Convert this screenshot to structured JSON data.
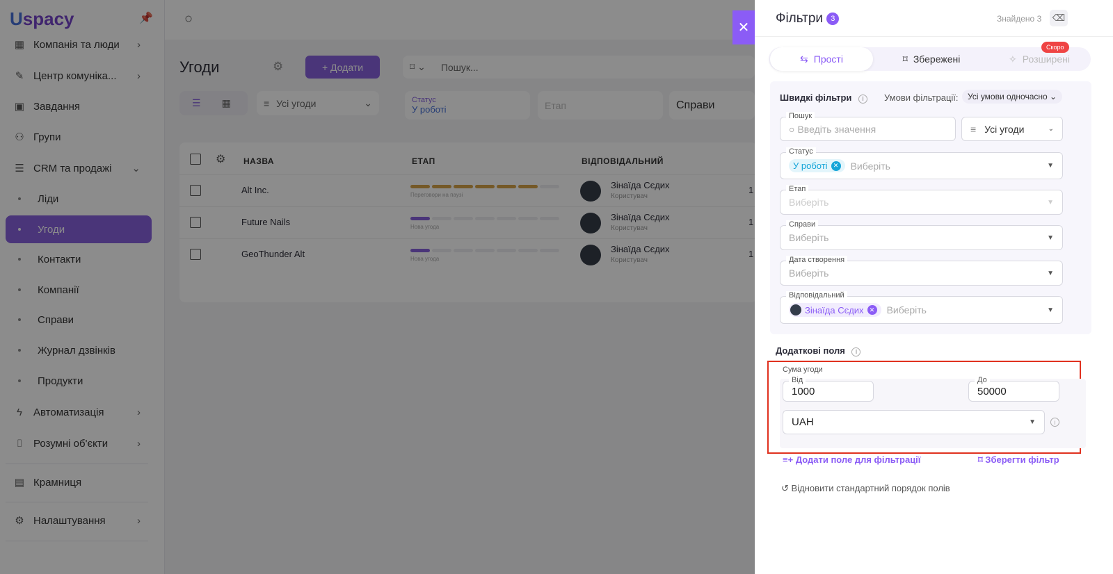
{
  "brand": {
    "logo_text": "spacy",
    "logo_initial": "U"
  },
  "sidebar": {
    "items": [
      {
        "label": "Компанія та люди",
        "icon": "building-icon"
      },
      {
        "label": "Центр комуніка...",
        "icon": "chat-icon"
      },
      {
        "label": "Завдання",
        "icon": "calendar-icon"
      },
      {
        "label": "Групи",
        "icon": "users-icon"
      },
      {
        "label": "CRM та продажі",
        "icon": "database-icon"
      },
      {
        "label": "Ліди"
      },
      {
        "label": "Угоди"
      },
      {
        "label": "Контакти"
      },
      {
        "label": "Компанії"
      },
      {
        "label": "Справи"
      },
      {
        "label": "Журнал дзвінків"
      },
      {
        "label": "Продукти"
      },
      {
        "label": "Автоматизація",
        "icon": "lightning-icon"
      },
      {
        "label": "Розумні об'єкти",
        "icon": "scan-icon"
      },
      {
        "label": "Крамниця",
        "icon": "store-icon"
      },
      {
        "label": "Налаштування",
        "icon": "gear-icon"
      }
    ]
  },
  "main": {
    "title": "Угоди",
    "add_label": "+ Додати",
    "search_placeholder": "Пошук...",
    "view_filter": "Усі угоди",
    "filters": {
      "status_label": "Статус",
      "status_value": "У роботі",
      "stage": "Етап",
      "cases": "Справи"
    },
    "columns": [
      "НАЗВА",
      "ЕТАП",
      "ВІДПОВІДАЛЬНИЙ"
    ],
    "rows": [
      {
        "name": "Alt Inc.",
        "stage": "Переговори на паузі",
        "progress": 6,
        "stage_total": 7,
        "stage_color": "#e0a030",
        "owner": "Зінаїда Сєдих",
        "role": "Користувач",
        "date": "1"
      },
      {
        "name": "Future Nails",
        "stage": "Нова угода",
        "progress": 1,
        "stage_total": 7,
        "stage_color": "#8b5cf6",
        "owner": "Зінаїда Сєдих",
        "role": "Користувач",
        "date": "1"
      },
      {
        "name": "GeoThunder Alt",
        "stage": "Нова угода",
        "progress": 1,
        "stage_total": 7,
        "stage_color": "#8b5cf6",
        "owner": "Зінаїда Сєдих",
        "role": "Користувач",
        "date": "1"
      }
    ]
  },
  "panel": {
    "title": "Фільтри",
    "count": "3",
    "found": "Знайдено 3",
    "tabs": [
      {
        "label": "Прості"
      },
      {
        "label": "Збережені"
      },
      {
        "label": "Розширені",
        "badge": "Скоро"
      }
    ],
    "quick_title": "Швидкі фільтри",
    "conditions_label": "Умови фільтрації:",
    "conditions_value": "Усі умови одночасно",
    "search_label": "Пошук",
    "search_placeholder": "Введіть значення",
    "scope_value": "Усі угоди",
    "status_label": "Статус",
    "status_chip": "У роботі",
    "select_placeholder": "Виберіть",
    "stage_label": "Етап",
    "cases_label": "Справи",
    "created_label": "Дата створення",
    "owner_label": "Відповідальний",
    "owner_chip": "Зінаїда Сєдих",
    "extra_title": "Додаткові поля",
    "amount_label": "Сума угоди",
    "from_label": "Від",
    "from_value": "1000",
    "to_label": "До",
    "to_value": "50000",
    "currency": "UAH",
    "add_field": "Додати поле для фільтрації",
    "save_filter": "Зберегти фільтр",
    "reset_order": "Відновити стандартний порядок полів"
  },
  "colors": {
    "accent": "#8b5cf6",
    "highlight": "#e0311f",
    "soon": "#ef4444",
    "status_chip": "#16a5d8"
  }
}
